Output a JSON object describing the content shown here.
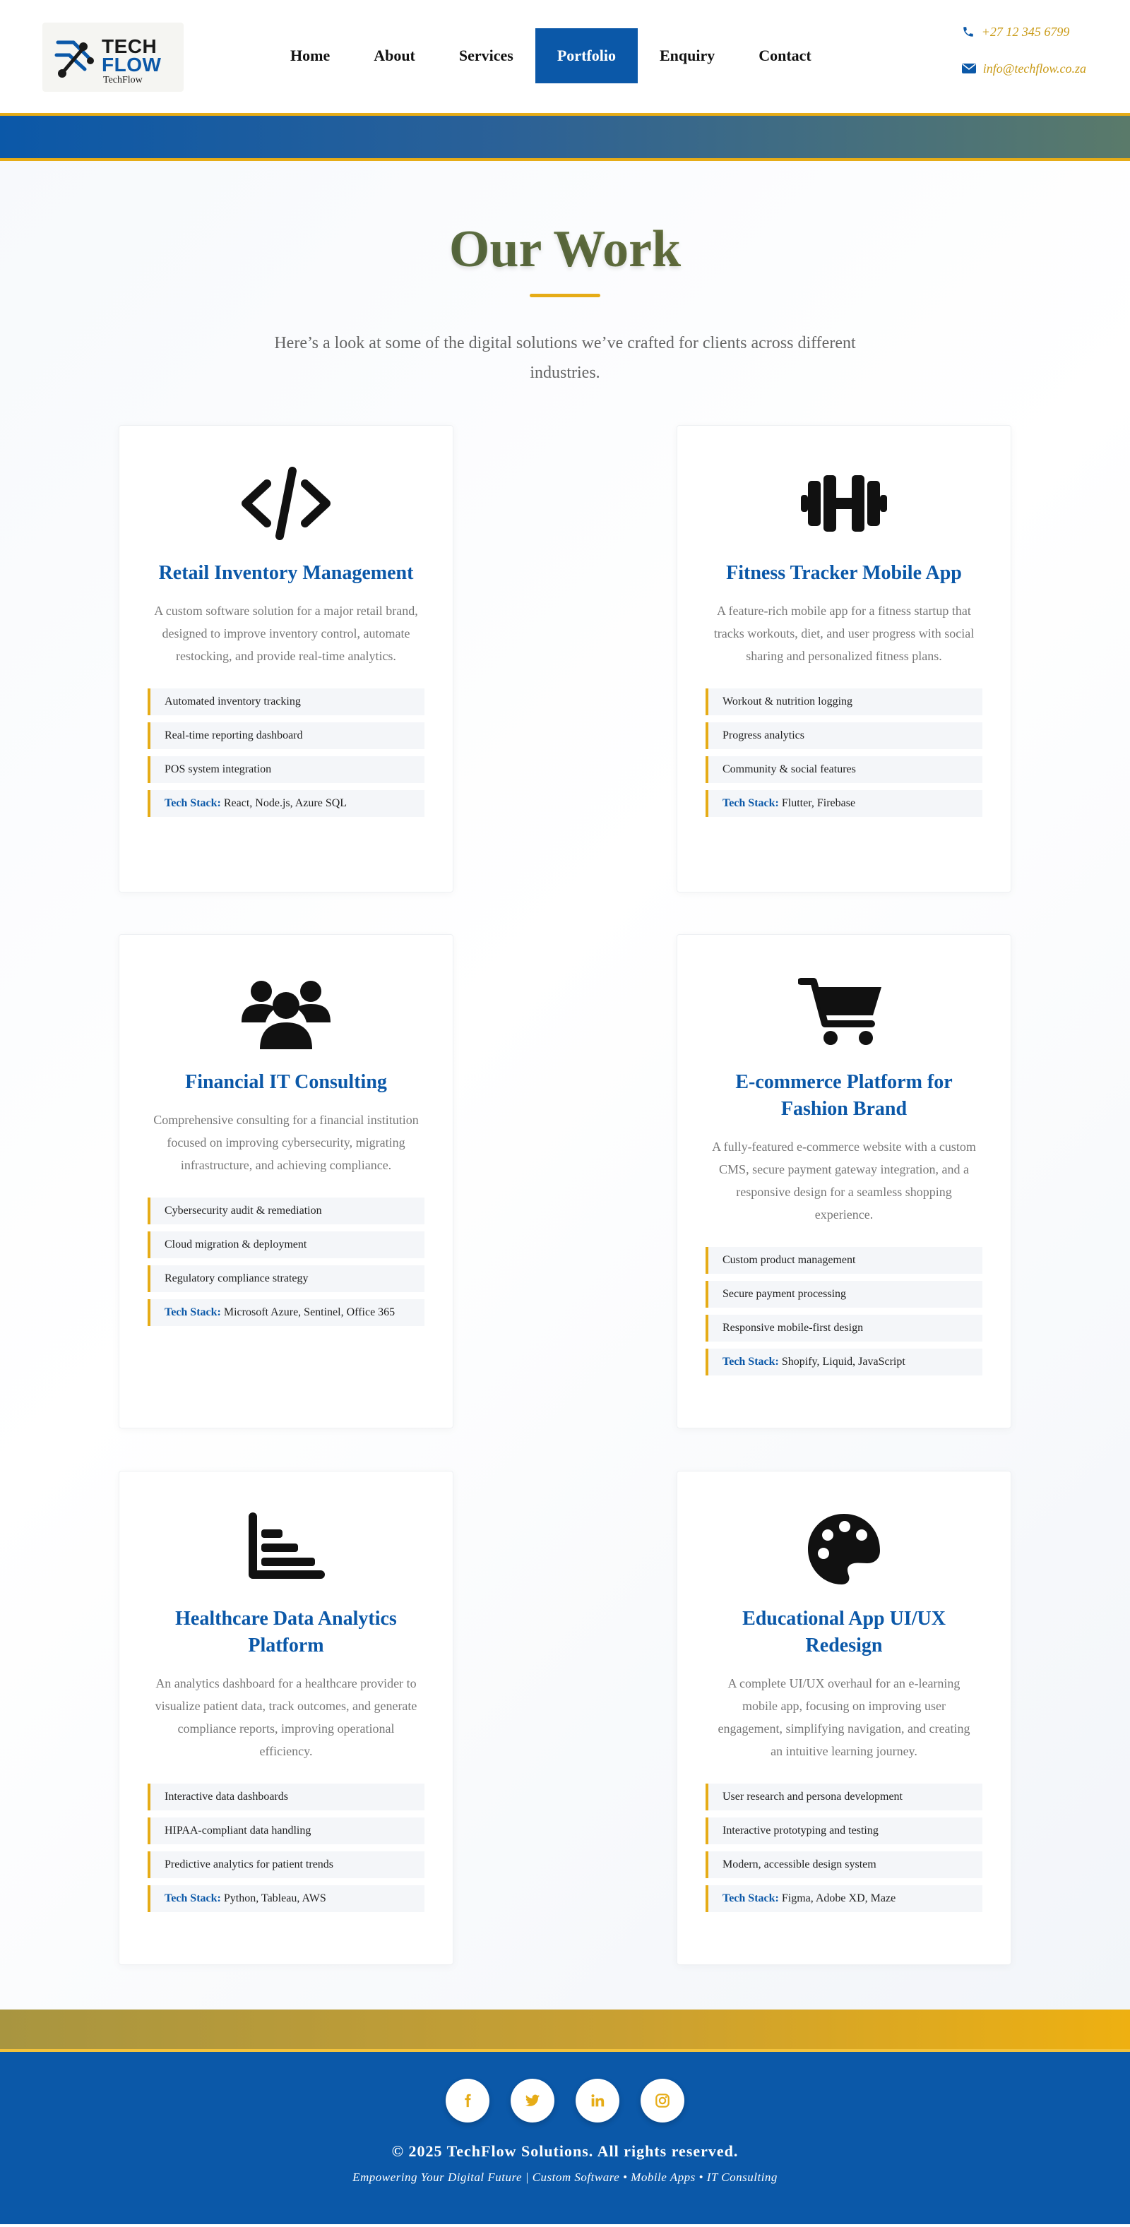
{
  "brand": {
    "name_line1": "TECH",
    "name_line2": "FLOW",
    "sub": "TechFlow",
    "colors": {
      "primary": "#0b58a8",
      "accent": "#e6ac17"
    }
  },
  "nav": {
    "items": [
      {
        "label": "Home"
      },
      {
        "label": "About"
      },
      {
        "label": "Services"
      },
      {
        "label": "Portfolio",
        "active": true
      },
      {
        "label": "Enquiry"
      },
      {
        "label": "Contact"
      }
    ]
  },
  "contact": {
    "phone": "+27 12 345 6799",
    "phone_icon": "phone-icon",
    "email": "info@techflow.co.za",
    "email_icon": "envelope-icon"
  },
  "portfolio": {
    "title": "Our Work",
    "intro": "Here’s a look at some of the digital solutions we’ve crafted for clients across different industries.",
    "tech_stack_label": "Tech Stack:",
    "projects": [
      {
        "icon": "code-icon",
        "title": "Retail Inventory Management",
        "description": "A custom software solution for a major retail brand, designed to improve inventory control, automate restocking, and provide real-time analytics.",
        "features": [
          "Automated inventory tracking",
          "Real-time reporting dashboard",
          "POS system integration"
        ],
        "tech_stack": "React, Node.js, Azure SQL"
      },
      {
        "icon": "dumbbell-icon",
        "title": "Fitness Tracker Mobile App",
        "description": "A feature-rich mobile app for a fitness startup that tracks workouts, diet, and user progress with social sharing and personalized fitness plans.",
        "features": [
          "Workout & nutrition logging",
          "Progress analytics",
          "Community & social features"
        ],
        "tech_stack": "Flutter, Firebase"
      },
      {
        "icon": "users-icon",
        "title": "Financial IT Consulting",
        "description": "Comprehensive consulting for a financial institution focused on improving cybersecurity, migrating infrastructure, and achieving compliance.",
        "features": [
          "Cybersecurity audit & remediation",
          "Cloud migration & deployment",
          "Regulatory compliance strategy"
        ],
        "tech_stack": "Microsoft Azure, Sentinel, Office 365"
      },
      {
        "icon": "shopping-cart-icon",
        "title": "E-commerce Platform for Fashion Brand",
        "description": "A fully-featured e-commerce website with a custom CMS, secure payment gateway integration, and a responsive design for a seamless shopping experience.",
        "features": [
          "Custom product management",
          "Secure payment processing",
          "Responsive mobile-first design"
        ],
        "tech_stack": "Shopify, Liquid, JavaScript"
      },
      {
        "icon": "bar-chart-icon",
        "title": "Healthcare Data Analytics Platform",
        "description": "An analytics dashboard for a healthcare provider to visualize patient data, track outcomes, and generate compliance reports, improving operational efficiency.",
        "features": [
          "Interactive data dashboards",
          "HIPAA-compliant data handling",
          "Predictive analytics for patient trends"
        ],
        "tech_stack": "Python, Tableau, AWS"
      },
      {
        "icon": "palette-icon",
        "title": "Educational App UI/UX Redesign",
        "description": "A complete UI/UX overhaul for an e-learning mobile app, focusing on improving user engagement, simplifying navigation, and creating an intuitive learning journey.",
        "features": [
          "User research and persona development",
          "Interactive prototyping and testing",
          "Modern, accessible design system"
        ],
        "tech_stack": "Figma, Adobe XD, Maze"
      }
    ]
  },
  "footer": {
    "socials": [
      {
        "icon": "facebook-icon"
      },
      {
        "icon": "twitter-icon"
      },
      {
        "icon": "linkedin-icon"
      },
      {
        "icon": "instagram-icon"
      }
    ],
    "copyright": "© 2025 TechFlow Solutions. All rights reserved.",
    "tagline": "Empowering Your Digital Future | Custom Software • Mobile Apps • IT Consulting"
  }
}
